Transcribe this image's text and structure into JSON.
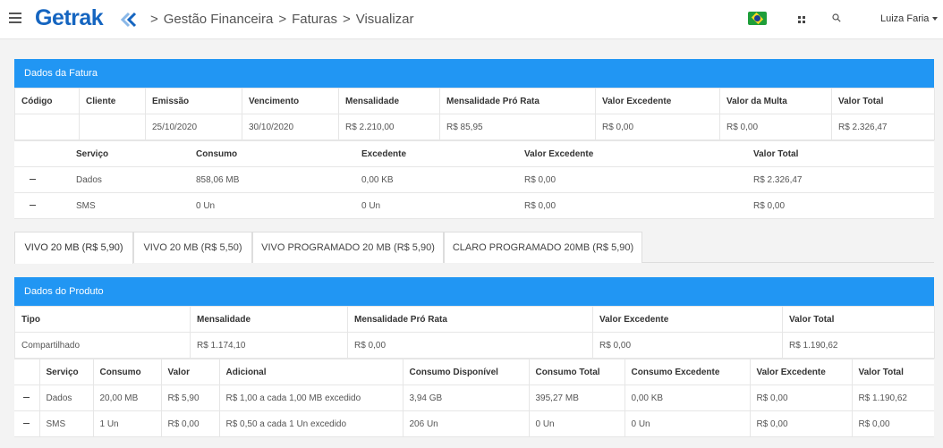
{
  "header": {
    "logo_text": "Getrak",
    "breadcrumb": [
      "Gestão Financeira",
      "Faturas",
      "Visualizar"
    ],
    "breadcrumb_separator": ">",
    "user_name": "Luiza Faria"
  },
  "fatura": {
    "panel_title": "Dados da Fatura",
    "columns": [
      "Código",
      "Cliente",
      "Emissão",
      "Vencimento",
      "Mensalidade",
      "Mensalidade Pró Rata",
      "Valor Excedente",
      "Valor da Multa",
      "Valor Total"
    ],
    "row": [
      "",
      "",
      "25/10/2020",
      "30/10/2020",
      "R$ 2.210,00",
      "R$ 85,95",
      "R$ 0,00",
      "R$ 0,00",
      "R$ 2.326,47"
    ],
    "services_columns": [
      "Serviço",
      "Consumo",
      "Excedente",
      "Valor Excedente",
      "Valor Total"
    ],
    "services": [
      [
        "Dados",
        "858,06 MB",
        "0,00 KB",
        "R$ 0,00",
        "R$ 2.326,47"
      ],
      [
        "SMS",
        "0 Un",
        "0 Un",
        "R$ 0,00",
        "R$ 0,00"
      ]
    ]
  },
  "tabs": [
    "VIVO 20 MB (R$ 5,90)",
    "VIVO 20 MB (R$ 5,50)",
    "VIVO PROGRAMADO 20 MB (R$ 5,90)",
    "CLARO PROGRAMADO 20MB (R$ 5,90)"
  ],
  "produto": {
    "panel_title": "Dados do Produto",
    "columns": [
      "Tipo",
      "Mensalidade",
      "Mensalidade Pró Rata",
      "Valor Excedente",
      "Valor Total"
    ],
    "row": [
      "Compartilhado",
      "R$ 1.174,10",
      "R$ 0,00",
      "R$ 0,00",
      "R$ 1.190,62"
    ],
    "services_columns": [
      "Serviço",
      "Consumo",
      "Valor",
      "Adicional",
      "Consumo Disponível",
      "Consumo Total",
      "Consumo Excedente",
      "Valor Excedente",
      "Valor Total"
    ],
    "services": [
      [
        "Dados",
        "20,00 MB",
        "R$ 5,90",
        "R$ 1,00 a cada 1,00 MB excedido",
        "3,94 GB",
        "395,27 MB",
        "0,00 KB",
        "R$ 0,00",
        "R$ 1.190,62"
      ],
      [
        "SMS",
        "1 Un",
        "R$ 0,00",
        "R$ 0,50 a cada 1 Un excedido",
        "206 Un",
        "0 Un",
        "0 Un",
        "R$ 0,00",
        "R$ 0,00"
      ]
    ]
  },
  "icons": {
    "menu": "hamburger-icon",
    "flag": "brazil-flag-icon",
    "apps": "apps-grid-icon",
    "search": "search-icon",
    "expand": "collapse-dash-icon"
  }
}
